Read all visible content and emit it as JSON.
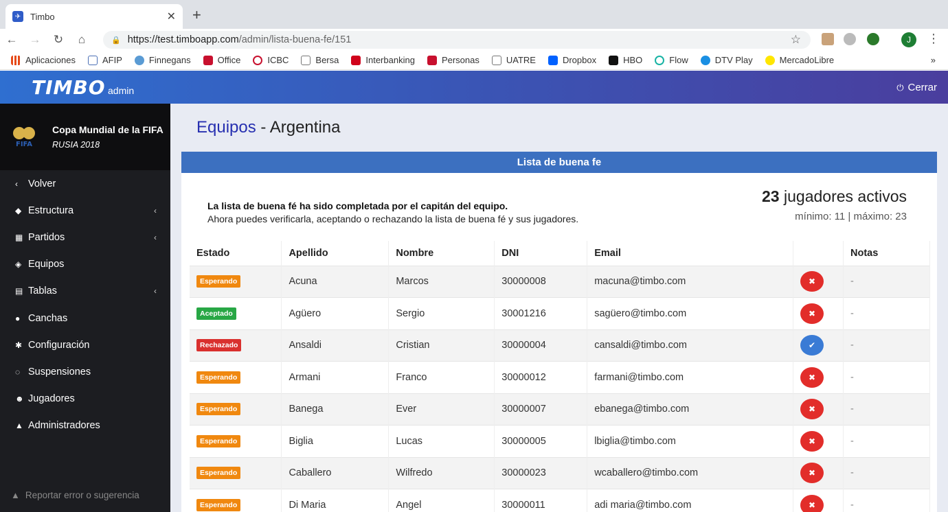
{
  "browser": {
    "tab_title": "Timbo",
    "url_host": "https://test.timboapp.com",
    "url_path": "/admin/lista-buena-fe/151",
    "profile_initial": "J",
    "bookmarks": [
      "Aplicaciones",
      "AFIP",
      "Finnegans",
      "Office",
      "ICBC",
      "Bersa",
      "Interbanking",
      "Personas",
      "UATRE",
      "Dropbox",
      "HBO",
      "Flow",
      "DTV Play",
      "MercadoLibre"
    ],
    "bookmarks_more": "»"
  },
  "header": {
    "logo": "TIMBO",
    "logo_sub": "admin",
    "logout_label": "Cerrar"
  },
  "sidebar": {
    "competition_name": "Copa Mundial de la FIFA",
    "competition_sub": "RUSIA 2018",
    "items": [
      {
        "label": "Volver",
        "icon": "‹",
        "chevron": ""
      },
      {
        "label": "Estructura",
        "icon": "◆",
        "chevron": "‹"
      },
      {
        "label": "Partidos",
        "icon": "▦",
        "chevron": "‹"
      },
      {
        "label": "Equipos",
        "icon": "◈",
        "chevron": ""
      },
      {
        "label": "Tablas",
        "icon": "▤",
        "chevron": "‹"
      },
      {
        "label": "Canchas",
        "icon": "●",
        "chevron": ""
      },
      {
        "label": "Configuración",
        "icon": "✱",
        "chevron": ""
      },
      {
        "label": "Suspensiones",
        "icon": "◌",
        "chevron": ""
      },
      {
        "label": "Jugadores",
        "icon": "☻",
        "chevron": ""
      },
      {
        "label": "Administradores",
        "icon": "▲",
        "chevron": ""
      }
    ],
    "report_label": "Reportar error o sugerencia"
  },
  "page": {
    "title_main": "Equipos",
    "title_sub": " - Argentina",
    "panel_title": "Lista de buena fe",
    "message_bold": "La lista de buena fé ha sido completada por el capitán del equipo.",
    "message": "Ahora puedes verificarla, aceptando o rechazando la lista de buena fé y sus jugadores.",
    "active_count": "23",
    "active_label": " jugadores activos",
    "active_range": "mínimo: 11 | máximo: 23"
  },
  "table": {
    "headers": [
      "Estado",
      "Apellido",
      "Nombre",
      "DNI",
      "Email",
      "",
      "Notas"
    ],
    "rows": [
      {
        "estado": "Esperando",
        "apellido": "Acuna",
        "nombre": "Marcos",
        "dni": "30000008",
        "email": "macuna@timbo.com",
        "action": "✖",
        "notas": "-"
      },
      {
        "estado": "Aceptado",
        "apellido": "Agüero",
        "nombre": "Sergio",
        "dni": "30001216",
        "email": "sagüero@timbo.com",
        "action": "✖",
        "notas": "-"
      },
      {
        "estado": "Rechazado",
        "apellido": "Ansaldi",
        "nombre": "Cristian",
        "dni": "30000004",
        "email": "cansaldi@timbo.com",
        "action": "✔",
        "notas": "-"
      },
      {
        "estado": "Esperando",
        "apellido": "Armani",
        "nombre": "Franco",
        "dni": "30000012",
        "email": "farmani@timbo.com",
        "action": "✖",
        "notas": "-"
      },
      {
        "estado": "Esperando",
        "apellido": "Banega",
        "nombre": "Ever",
        "dni": "30000007",
        "email": "ebanega@timbo.com",
        "action": "✖",
        "notas": "-"
      },
      {
        "estado": "Esperando",
        "apellido": "Biglia",
        "nombre": "Lucas",
        "dni": "30000005",
        "email": "lbiglia@timbo.com",
        "action": "✖",
        "notas": "-"
      },
      {
        "estado": "Esperando",
        "apellido": "Caballero",
        "nombre": "Wilfredo",
        "dni": "30000023",
        "email": "wcaballero@timbo.com",
        "action": "✖",
        "notas": "-"
      },
      {
        "estado": "Esperando",
        "apellido": "Di Maria",
        "nombre": "Angel",
        "dni": "30000011",
        "email": "adi maria@timbo.com",
        "action": "✖",
        "notas": "-"
      }
    ]
  }
}
